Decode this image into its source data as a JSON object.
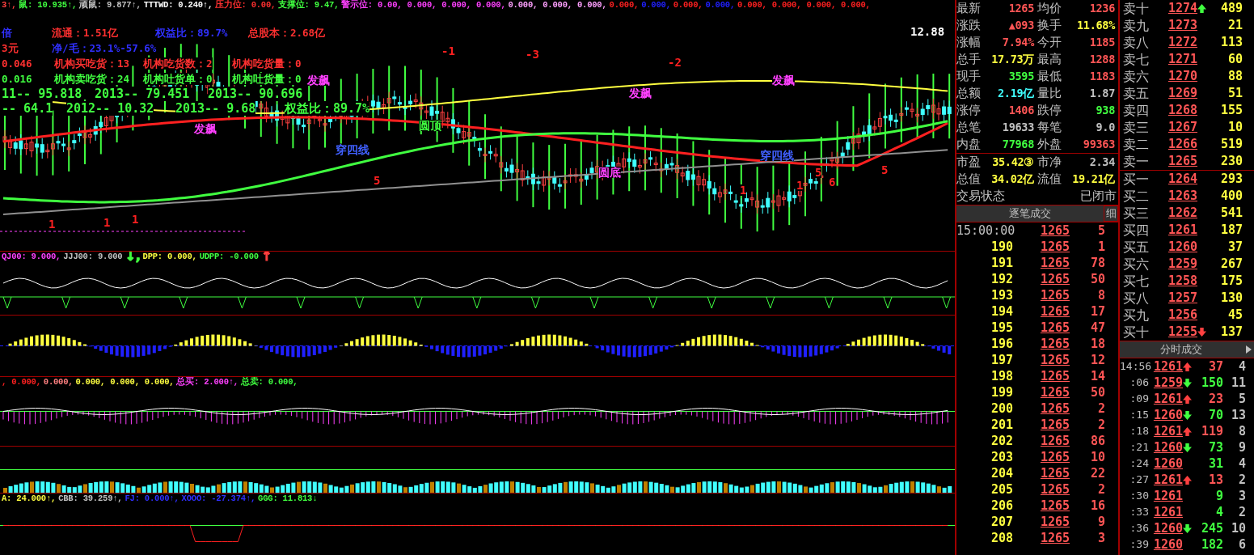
{
  "chart": {
    "header": [
      {
        "text": "3↑,",
        "color": "#ff4040"
      },
      {
        "text": "鼠: 10.935↑,",
        "color": "#40ff40"
      },
      {
        "text": "顽鼠: 9.877↑,",
        "color": "#c0c0c0"
      },
      {
        "text": "TTTWD: 0.240↑,",
        "color": "#ffffff"
      },
      {
        "text": "压力位: 0.00,",
        "color": "#ff3030"
      },
      {
        "text": "支撑位: 9.47,",
        "color": "#40ff40"
      },
      {
        "text": "警示位: 0.00, 0.000, 0.000, 0.000,",
        "color": "#ff40ff"
      },
      {
        "text": "0.000, 0.000, 0.000,",
        "color": "#ffa0ff"
      },
      {
        "text": "0.000,",
        "color": "#ff2020"
      },
      {
        "text": "0.000,",
        "color": "#2020ff"
      },
      {
        "text": "0.000,",
        "color": "#ff2020"
      },
      {
        "text": "0.000,",
        "color": "#2020ff"
      },
      {
        "text": "0.000, 0.000, 0.000, 0.000,",
        "color": "#ff2020"
      }
    ],
    "info_rows": [
      [
        {
          "text": "倍",
          "color": "#3030ff"
        },
        {
          "text": "流通：1.51亿",
          "color": "#ff3030"
        },
        {
          "text": "权益比：89.7%",
          "color": "#3030ff"
        },
        {
          "text": "总股本：2.68亿",
          "color": "#ff3030"
        }
      ],
      [
        {
          "text": "3元",
          "color": "#ff3030"
        },
        {
          "text": "净/毛：23.1%-57.6%",
          "color": "#3030ff"
        }
      ],
      [
        {
          "text": "0.046",
          "color": "#ff3030"
        },
        {
          "text": "机构买吃货：13",
          "color": "#ff3030"
        },
        {
          "text": "机构吃货数：2",
          "color": "#ff3030"
        },
        {
          "text": "机构吃货量：0",
          "color": "#ff3030"
        }
      ],
      [
        {
          "text": "0.016",
          "color": "#40ff40"
        },
        {
          "text": "机构卖吃货：24",
          "color": "#40ff40"
        },
        {
          "text": "机构吐货单：0",
          "color": "#40ff40"
        },
        {
          "text": "机构吐货量：0",
          "color": "#40ff40"
        }
      ],
      [
        {
          "text": "11-- 95.818",
          "color": "#40ff40"
        },
        {
          "text": "2013-- 79.451",
          "color": "#40ff40"
        },
        {
          "text": "2013-- 90.696",
          "color": "#40ff40"
        }
      ],
      [
        {
          "text": "-- 64.1",
          "color": "#40ff40"
        },
        {
          "text": "2012-- 10.32",
          "color": "#40ff40"
        },
        {
          "text": "2013-- 9.68",
          "color": "#40ff40"
        },
        {
          "text": "权益比：89.7%",
          "color": "#40ff40"
        }
      ]
    ],
    "annotations": [
      {
        "text": "发飙",
        "color": "#ff40ff"
      },
      {
        "text": "发飙",
        "color": "#ff40ff"
      },
      {
        "text": "发飙",
        "color": "#ff40ff"
      },
      {
        "text": "发飙",
        "color": "#ff40ff"
      },
      {
        "text": "圆顶",
        "color": "#40ff40"
      },
      {
        "text": "圆底",
        "color": "#ff40ff"
      },
      {
        "text": "穿四线",
        "color": "#4060ff"
      },
      {
        "text": "穿四线",
        "color": "#4060ff"
      },
      {
        "text": "12.88",
        "color": "#ffffff"
      },
      {
        "text": "-1",
        "color": "#ff2020"
      },
      {
        "text": "-3",
        "color": "#ff2020"
      },
      {
        "text": "-2",
        "color": "#ff2020"
      },
      {
        "text": "1",
        "color": "#ff2020"
      },
      {
        "text": "1",
        "color": "#ff2020"
      },
      {
        "text": "1",
        "color": "#ff2020"
      },
      {
        "text": "5",
        "color": "#ff2020"
      },
      {
        "text": "1",
        "color": "#ff2020"
      },
      {
        "text": "1",
        "color": "#ff2020"
      },
      {
        "text": "5",
        "color": "#ff2020"
      },
      {
        "text": "6",
        "color": "#ff2020"
      },
      {
        "text": "5",
        "color": "#ff2020"
      }
    ],
    "first_indicator": {
      "header": [
        {
          "text": "QJ00: 9.000,",
          "color": "#ff40ff"
        },
        {
          "text": "JJJ00: 9.000",
          "color": "#c0c0c0"
        },
        {
          "text": "↓,",
          "color": "#40ff40"
        },
        {
          "text": "DPP: 0.000,",
          "color": "#ffff40"
        },
        {
          "text": "UDPP: -0.000",
          "color": "#40ff40"
        },
        {
          "text": "↑",
          "color": "#ff4040"
        }
      ]
    },
    "third_indicator": {
      "header": [
        {
          "text": ", 0.000,",
          "color": "#ff2020"
        },
        {
          "text": "0.000,",
          "color": "#ff8080"
        },
        {
          "text": "0.000, 0.000, 0.000,",
          "color": "#ffff40"
        },
        {
          "text": "总买: 2.000↑,",
          "color": "#ff40ff"
        },
        {
          "text": "总卖: 0.000,",
          "color": "#40ff40"
        }
      ]
    },
    "fifth_indicator": {
      "header": [
        {
          "text": "A: 24.000↑,",
          "color": "#ffff40"
        },
        {
          "text": "CBB: 39.259↑,",
          "color": "#c0c0c0"
        },
        {
          "text": "FJ: 0.000↑,",
          "color": "#3030ff"
        },
        {
          "text": "XOOO: -27.374↑,",
          "color": "#3030ff"
        },
        {
          "text": "GGG: 11.813↓",
          "color": "#40ff40"
        }
      ]
    }
  },
  "quote": {
    "rows": [
      [
        {
          "label": "最新",
          "value": "1265",
          "color": "#ff5555"
        },
        {
          "label": "均价",
          "value": "1236",
          "color": "#ff5555"
        }
      ],
      [
        {
          "label": "涨跌",
          "value": "▲093",
          "color": "#ff5555"
        },
        {
          "label": "换手",
          "value": "11.68%",
          "color": "#ffff40"
        }
      ],
      [
        {
          "label": "涨幅",
          "value": "7.94%",
          "color": "#ff5555"
        },
        {
          "label": "今开",
          "value": "1185",
          "color": "#ff5555"
        }
      ],
      [
        {
          "label": "总手",
          "value": "17.73万",
          "color": "#ffff40"
        },
        {
          "label": "最高",
          "value": "1288",
          "color": "#ff5555"
        }
      ],
      [
        {
          "label": "现手",
          "value": "3595",
          "color": "#40ff40"
        },
        {
          "label": "最低",
          "value": "1183",
          "color": "#ff5555"
        }
      ],
      [
        {
          "label": "总额",
          "value": "2.19亿",
          "color": "#40ffff"
        },
        {
          "label": "量比",
          "value": "1.87",
          "color": "#c0c0c0"
        }
      ],
      [
        {
          "label": "涨停",
          "value": "1406",
          "color": "#ff5555"
        },
        {
          "label": "跌停",
          "value": "938",
          "color": "#40ff40"
        }
      ],
      [
        {
          "label": "总笔",
          "value": "19633",
          "color": "#c0c0c0"
        },
        {
          "label": "每笔",
          "value": "9.0",
          "color": "#c0c0c0"
        }
      ],
      [
        {
          "label": "内盘",
          "value": "77968",
          "color": "#40ff40"
        },
        {
          "label": "外盘",
          "value": "99363",
          "color": "#ff5555"
        }
      ]
    ],
    "valuation_rows": [
      [
        {
          "label": "市盈",
          "value": "35.42③",
          "color": "#ffff40"
        },
        {
          "label": "市净",
          "value": "2.34",
          "color": "#c0c0c0"
        }
      ],
      [
        {
          "label": "总值",
          "value": "34.02亿",
          "color": "#ffff40"
        },
        {
          "label": "流值",
          "value": "19.21亿",
          "color": "#ffff40"
        }
      ]
    ],
    "status": {
      "label": "交易状态",
      "value": "已闭市"
    }
  },
  "order_book": {
    "asks": [
      {
        "label": "卖十",
        "price": "1274",
        "volume": "489",
        "kind": "up"
      },
      {
        "label": "卖九",
        "price": "1273",
        "volume": "21",
        "kind": "plain"
      },
      {
        "label": "卖八",
        "price": "1272",
        "volume": "113",
        "kind": "plain"
      },
      {
        "label": "卖七",
        "price": "1271",
        "volume": "60",
        "kind": "plain"
      },
      {
        "label": "卖六",
        "price": "1270",
        "volume": "88",
        "kind": "plain"
      },
      {
        "label": "卖五",
        "price": "1269",
        "volume": "51",
        "kind": "plain"
      },
      {
        "label": "卖四",
        "price": "1268",
        "volume": "155",
        "kind": "plain"
      },
      {
        "label": "卖三",
        "price": "1267",
        "volume": "10",
        "kind": "plain"
      },
      {
        "label": "卖二",
        "price": "1266",
        "volume": "519",
        "kind": "plain"
      },
      {
        "label": "卖一",
        "price": "1265",
        "volume": "230",
        "kind": "plain"
      }
    ],
    "bids": [
      {
        "label": "买一",
        "price": "1264",
        "volume": "293",
        "kind": "plain"
      },
      {
        "label": "买二",
        "price": "1263",
        "volume": "400",
        "kind": "plain"
      },
      {
        "label": "买三",
        "price": "1262",
        "volume": "541",
        "kind": "plain"
      },
      {
        "label": "买四",
        "price": "1261",
        "volume": "187",
        "kind": "plain"
      },
      {
        "label": "买五",
        "price": "1260",
        "volume": "37",
        "kind": "plain"
      },
      {
        "label": "买六",
        "price": "1259",
        "volume": "267",
        "kind": "plain"
      },
      {
        "label": "买七",
        "price": "1258",
        "volume": "175",
        "kind": "plain"
      },
      {
        "label": "买八",
        "price": "1257",
        "volume": "130",
        "kind": "plain"
      },
      {
        "label": "买九",
        "price": "1256",
        "volume": "45",
        "kind": "plain"
      },
      {
        "label": "买十",
        "price": "1255",
        "volume": "137",
        "kind": "down"
      }
    ]
  },
  "ticks": {
    "title": "逐笔成交",
    "detail_button": "细",
    "rows": [
      {
        "kind": "time",
        "time": "15:00:00",
        "price": "1265",
        "volume": "5"
      },
      {
        "kind": "seq",
        "time": "190",
        "price": "1265",
        "volume": "1"
      },
      {
        "kind": "seq",
        "time": "191",
        "price": "1265",
        "volume": "78"
      },
      {
        "kind": "seq",
        "time": "192",
        "price": "1265",
        "volume": "50"
      },
      {
        "kind": "seq",
        "time": "193",
        "price": "1265",
        "volume": "8"
      },
      {
        "kind": "seq",
        "time": "194",
        "price": "1265",
        "volume": "17"
      },
      {
        "kind": "seq",
        "time": "195",
        "price": "1265",
        "volume": "47"
      },
      {
        "kind": "seq",
        "time": "196",
        "price": "1265",
        "volume": "18"
      },
      {
        "kind": "seq",
        "time": "197",
        "price": "1265",
        "volume": "12"
      },
      {
        "kind": "seq",
        "time": "198",
        "price": "1265",
        "volume": "14"
      },
      {
        "kind": "seq",
        "time": "199",
        "price": "1265",
        "volume": "50"
      },
      {
        "kind": "seq",
        "time": "200",
        "price": "1265",
        "volume": "2"
      },
      {
        "kind": "seq",
        "time": "201",
        "price": "1265",
        "volume": "2"
      },
      {
        "kind": "seq",
        "time": "202",
        "price": "1265",
        "volume": "86"
      },
      {
        "kind": "seq",
        "time": "203",
        "price": "1265",
        "volume": "10"
      },
      {
        "kind": "seq",
        "time": "204",
        "price": "1265",
        "volume": "22"
      },
      {
        "kind": "seq",
        "time": "205",
        "price": "1265",
        "volume": "2"
      },
      {
        "kind": "seq",
        "time": "206",
        "price": "1265",
        "volume": "16"
      },
      {
        "kind": "seq",
        "time": "207",
        "price": "1265",
        "volume": "9"
      },
      {
        "kind": "seq",
        "time": "208",
        "price": "1265",
        "volume": "3"
      }
    ]
  },
  "minute_trades": {
    "title": "分时成交",
    "rows": [
      {
        "time": "14:56",
        "price": "1261",
        "kind": "up",
        "volume": "37",
        "color": "#ff5555",
        "column_4": "4"
      },
      {
        "time": ":06",
        "price": "1259",
        "kind": "down",
        "volume": "150",
        "color": "#40ff40",
        "column_4": "11"
      },
      {
        "time": ":09",
        "price": "1261",
        "kind": "up",
        "volume": "23",
        "color": "#ff5555",
        "column_4": "5"
      },
      {
        "time": ":15",
        "price": "1260",
        "kind": "down",
        "volume": "70",
        "color": "#40ff40",
        "column_4": "13"
      },
      {
        "time": ":18",
        "price": "1261",
        "kind": "up",
        "volume": "119",
        "color": "#ff5555",
        "column_4": "8"
      },
      {
        "time": ":21",
        "price": "1260",
        "kind": "down",
        "volume": "73",
        "color": "#40ff40",
        "column_4": "9"
      },
      {
        "time": ":24",
        "price": "1260",
        "kind": "plain",
        "volume": "31",
        "color": "#40ff40",
        "column_4": "4"
      },
      {
        "time": ":27",
        "price": "1261",
        "kind": "up",
        "volume": "13",
        "color": "#ff5555",
        "column_4": "2"
      },
      {
        "time": ":30",
        "price": "1261",
        "kind": "plain",
        "volume": "9",
        "color": "#40ff40",
        "column_4": "3"
      },
      {
        "time": ":33",
        "price": "1261",
        "kind": "plain",
        "volume": "4",
        "color": "#40ff40",
        "column_4": "2"
      },
      {
        "time": ":36",
        "price": "1260",
        "kind": "down",
        "volume": "245",
        "color": "#40ff40",
        "column_4": "10"
      },
      {
        "time": ":39",
        "price": "1260",
        "kind": "plain",
        "volume": "182",
        "color": "#40ff40",
        "column_4": "6"
      }
    ]
  }
}
